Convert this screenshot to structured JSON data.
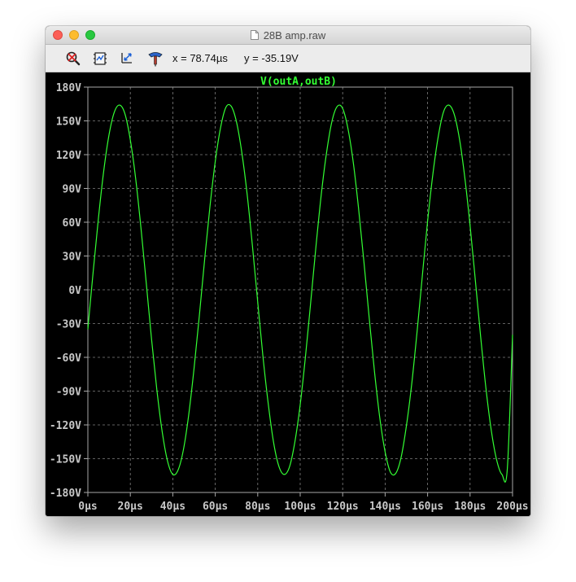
{
  "window": {
    "title": "28B amp.raw"
  },
  "toolbar": {
    "tools": [
      "zoom-reset-icon",
      "autorange-icon",
      "pan-icon",
      "probe-icon"
    ],
    "x_readout": "x = 78.74µs",
    "y_readout": "y = -35.19V"
  },
  "colors": {
    "background": "#000000",
    "trace": "#33ff33",
    "axis_text": "#c8c8c8",
    "grid": "#808080"
  },
  "chart_data": {
    "type": "line",
    "title": "V(outA,outB)",
    "xlabel": "",
    "ylabel": "",
    "x_unit": "µs",
    "y_unit": "V",
    "xlim": [
      0,
      200
    ],
    "ylim": [
      -180,
      180
    ],
    "grid": true,
    "x_ticks": [
      "0µs",
      "20µs",
      "40µs",
      "60µs",
      "80µs",
      "100µs",
      "120µs",
      "140µs",
      "160µs",
      "180µs",
      "200µs"
    ],
    "y_ticks": [
      "180V",
      "150V",
      "120V",
      "90V",
      "60V",
      "30V",
      "0V",
      "-30V",
      "-60V",
      "-90V",
      "-120V",
      "-150V",
      "-180V"
    ],
    "series": [
      {
        "name": "V(outA,outB)",
        "x": [
          0,
          2.5,
          5,
          7.5,
          10,
          12.5,
          15,
          17.5,
          20,
          22.5,
          25,
          27.5,
          30,
          32.5,
          35,
          37.5,
          40,
          42.5,
          45,
          47.5,
          50,
          52.5,
          55,
          57.5,
          60,
          62.5,
          65,
          67.5,
          70,
          72.5,
          75,
          77.5,
          80,
          82.5,
          85,
          87.5,
          90,
          92.5,
          95,
          97.5,
          100,
          102.5,
          105,
          107.5,
          110,
          112.5,
          115,
          117.5,
          120,
          122.5,
          125,
          127.5,
          130,
          132.5,
          135,
          137.5,
          140,
          142.5,
          145,
          147.5,
          150,
          152.5,
          155,
          157.5,
          160,
          162.5,
          165,
          167.5,
          170,
          172.5,
          175,
          177.5,
          180,
          182.5,
          185,
          187.5,
          190,
          192.5,
          195,
          197.5,
          200
        ],
        "y": [
          -35,
          16,
          64,
          106,
          138,
          158,
          164,
          156,
          133,
          99,
          55,
          6,
          -44,
          -89,
          -126,
          -152,
          -164,
          -160,
          -142,
          -111,
          -70,
          -23,
          27,
          74,
          114,
          144,
          162,
          163,
          149,
          122,
          85,
          39,
          -11,
          -60,
          -102,
          -136,
          -157,
          -164,
          -157,
          -135,
          -102,
          -59,
          -10,
          40,
          86,
          123,
          150,
          163,
          161,
          143,
          113,
          72,
          25,
          -25,
          -73,
          -114,
          -144,
          -162,
          -163,
          -149,
          -121,
          -84,
          -38,
          12,
          61,
          103,
          136,
          158,
          164,
          156,
          134,
          100,
          57,
          8,
          -42,
          -88,
          -125,
          -151,
          -164,
          -160,
          -40
        ]
      }
    ]
  }
}
